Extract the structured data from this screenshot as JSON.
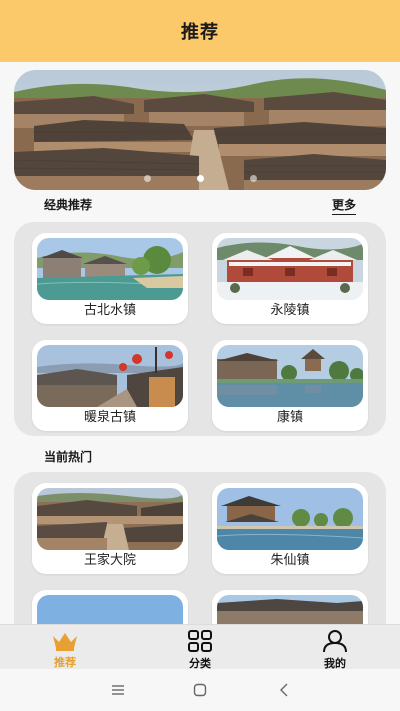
{
  "header": {
    "title": "推荐"
  },
  "banner": {
    "slide_count": 3,
    "active_index": 1
  },
  "classic": {
    "title": "经典推荐",
    "more_label": "更多",
    "items": [
      {
        "label": "古北水镇",
        "scene": "water-town"
      },
      {
        "label": "永陵镇",
        "scene": "snow-palace"
      },
      {
        "label": "暖泉古镇",
        "scene": "lantern-street"
      },
      {
        "label": "康镇",
        "scene": "lake-village"
      }
    ]
  },
  "hot": {
    "title": "当前热门",
    "items": [
      {
        "label": "王家大院",
        "scene": "courtyard"
      },
      {
        "label": "朱仙镇",
        "scene": "pavilion-lake"
      },
      {
        "label": "",
        "scene": "sky"
      },
      {
        "label": "",
        "scene": "roofline"
      }
    ]
  },
  "tabbar": {
    "items": [
      {
        "label": "推荐",
        "icon": "crown-icon",
        "active": true
      },
      {
        "label": "分类",
        "icon": "grid-icon",
        "active": false
      },
      {
        "label": "我的",
        "icon": "person-icon",
        "active": false
      }
    ]
  },
  "colors": {
    "header": "#fcc96a",
    "active_tab": "#e8a033",
    "panel": "#e5e5e5"
  }
}
